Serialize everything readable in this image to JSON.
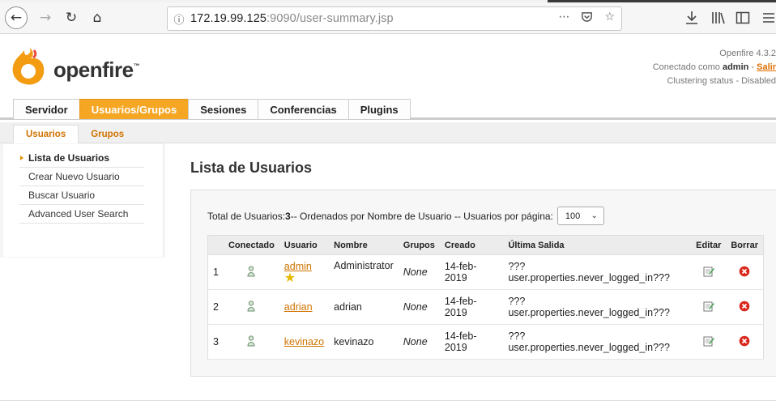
{
  "browser": {
    "url_host": "172.19.99.125",
    "url_rest": ":9090/user-summary.jsp",
    "icons": [
      "back-icon",
      "forward-icon",
      "reload-icon",
      "home-icon",
      "info-icon",
      "more-icon",
      "pocket-icon",
      "star-icon",
      "download-icon",
      "library-icon",
      "sidebar-icon"
    ]
  },
  "header": {
    "logo_text": "openfire",
    "logo_tm": "™",
    "version": "Openfire 4.3.2",
    "connected_prefix": "Conectado como ",
    "connected_user": "admin",
    "logout_sep": " - ",
    "logout_label": "Salir",
    "clustering": "Clustering status - Disabled"
  },
  "tabs": [
    {
      "label": "Servidor",
      "active": false
    },
    {
      "label": "Usuarios/Grupos",
      "active": true
    },
    {
      "label": "Sesiones",
      "active": false
    },
    {
      "label": "Conferencias",
      "active": false
    },
    {
      "label": "Plugins",
      "active": false
    }
  ],
  "subtabs": [
    {
      "label": "Usuarios",
      "active": true
    },
    {
      "label": "Grupos",
      "active": false
    }
  ],
  "sidebar": {
    "items": [
      {
        "label": "Lista de Usuarios",
        "active": true
      },
      {
        "label": "Crear Nuevo Usuario",
        "active": false
      },
      {
        "label": "Buscar Usuario",
        "active": false
      },
      {
        "label": "Advanced User Search",
        "active": false
      }
    ]
  },
  "main": {
    "title": "Lista de Usuarios",
    "summary_prefix": "Total de Usuarios: ",
    "total": "3",
    "summary_suffix": " -- Ordenados por Nombre de Usuario -- Usuarios por página:",
    "per_page": "100",
    "columns": [
      "",
      "Conectado",
      "Usuario",
      "Nombre",
      "Grupos",
      "Creado",
      "Última Salida",
      "Editar",
      "Borrar"
    ],
    "rows": [
      {
        "num": "1",
        "username": "admin",
        "name": "Administrator",
        "groups": "None",
        "created": "14-feb-2019",
        "last_logout": "???user.properties.never_logged_in???",
        "is_admin": true
      },
      {
        "num": "2",
        "username": "adrian",
        "name": "adrian",
        "groups": "None",
        "created": "14-feb-2019",
        "last_logout": "???user.properties.never_logged_in???",
        "is_admin": false
      },
      {
        "num": "3",
        "username": "kevinazo",
        "name": "kevinazo",
        "groups": "None",
        "created": "14-feb-2019",
        "last_logout": "???user.properties.never_logged_in???",
        "is_admin": false
      }
    ]
  },
  "colors": {
    "accent": "#f5a623",
    "link": "#d07300",
    "delete": "#d9281d"
  }
}
